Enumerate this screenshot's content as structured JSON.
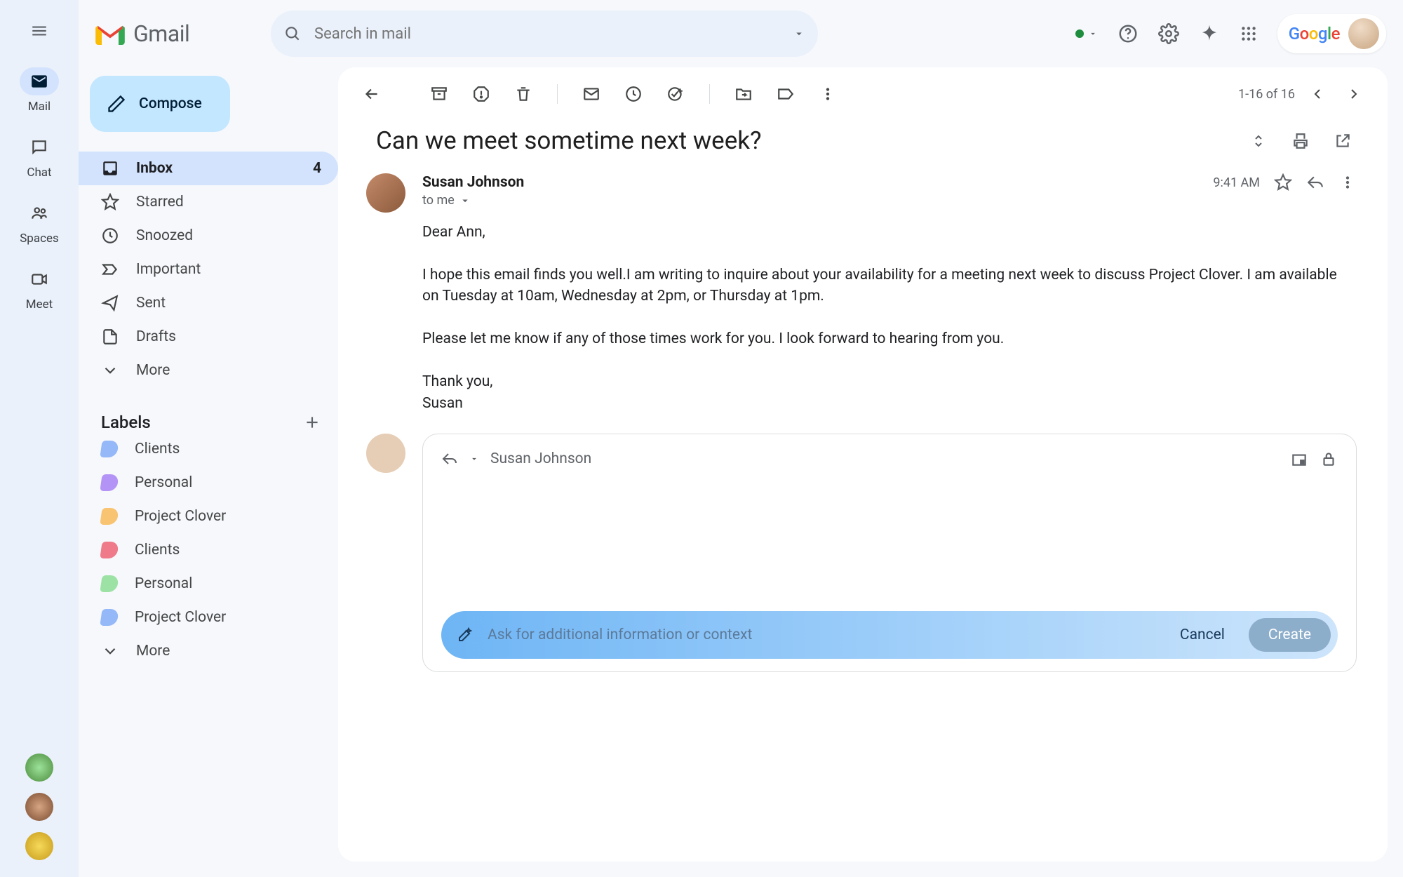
{
  "header": {
    "product": "Gmail",
    "search_placeholder": "Search in mail",
    "google": "Google"
  },
  "rail": {
    "items": [
      {
        "label": "Mail"
      },
      {
        "label": "Chat"
      },
      {
        "label": "Spaces"
      },
      {
        "label": "Meet"
      }
    ]
  },
  "compose": "Compose",
  "nav": {
    "items": [
      {
        "label": "Inbox",
        "count": "4"
      },
      {
        "label": "Starred"
      },
      {
        "label": "Snoozed"
      },
      {
        "label": "Important"
      },
      {
        "label": "Sent"
      },
      {
        "label": "Drafts"
      },
      {
        "label": "More"
      }
    ]
  },
  "labels": {
    "title": "Labels",
    "items": [
      {
        "label": "Clients",
        "color": "#94b8f8"
      },
      {
        "label": "Personal",
        "color": "#b493f6"
      },
      {
        "label": "Project Clover",
        "color": "#f8c471"
      },
      {
        "label": "Clients",
        "color": "#ef7a8a"
      },
      {
        "label": "Personal",
        "color": "#9de2a5"
      },
      {
        "label": "Project Clover",
        "color": "#94b8f8"
      }
    ],
    "more": "More"
  },
  "toolbar": {
    "counter": "1-16 of 16"
  },
  "subject": "Can we meet sometime next week?",
  "message": {
    "from": "Susan Johnson",
    "to": "to me",
    "time": "9:41 AM",
    "body": "Dear Ann,\n\nI hope this email finds you well.I am writing to inquire about your availability for a meeting next week to discuss Project Clover. I am available on Tuesday at 10am, Wednesday at 2pm, or Thursday at 1pm.\n\nPlease let me know if any of those times work for you. I look forward to hearing from you.\n\nThank you,\nSusan"
  },
  "reply": {
    "to": "Susan Johnson",
    "ai_placeholder": "Ask for additional information or context",
    "cancel": "Cancel",
    "create": "Create"
  }
}
